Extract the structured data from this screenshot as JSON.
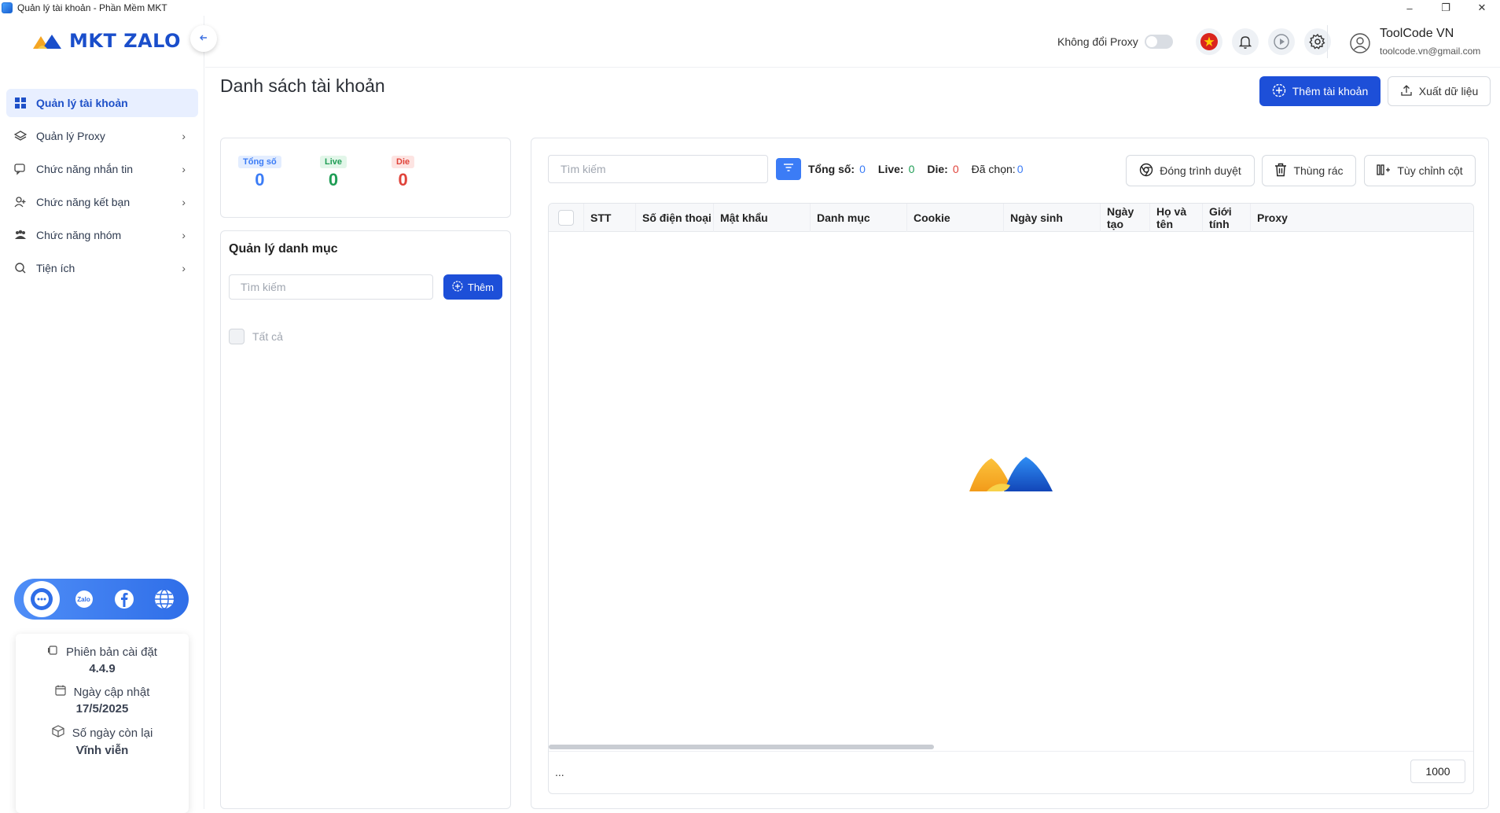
{
  "window": {
    "title": "Quản lý tài khoản - Phần Mềm MKT",
    "controls": [
      "–",
      "❐",
      "✕"
    ]
  },
  "brand": {
    "name": "MKT ZALO",
    "accent": "#1d4fd8"
  },
  "sidebar": {
    "items": [
      {
        "label": "Quản lý tài khoản",
        "icon": "grid-icon"
      },
      {
        "label": "Quản lý Proxy",
        "icon": "layers-icon"
      },
      {
        "label": "Chức năng nhắn tin",
        "icon": "chat-icon"
      },
      {
        "label": "Chức năng kết bạn",
        "icon": "user-plus-icon"
      },
      {
        "label": "Chức năng nhóm",
        "icon": "group-icon"
      },
      {
        "label": "Tiện ích",
        "icon": "search-icon"
      }
    ],
    "social": [
      "support-icon",
      "zalo-icon",
      "facebook-icon",
      "web-icon"
    ],
    "zalo_text": "Zalo",
    "info": {
      "version_label": "Phiên bản cài đặt",
      "version_value": "4.4.9",
      "update_label": "Ngày cập nhật",
      "update_value": "17/5/2025",
      "days_label": "Số ngày còn lại",
      "days_value": "Vĩnh viễn"
    }
  },
  "header": {
    "proxy_label": "Không đổi Proxy",
    "proxy_on": false,
    "user_name": "ToolCode VN",
    "user_email": "toolcode.vn@gmail.com"
  },
  "page": {
    "title": "Danh sách tài khoản",
    "add_account": "Thêm tài khoản",
    "export": "Xuất dữ liệu"
  },
  "stats": [
    {
      "label": "Tổng số",
      "value": "0",
      "color": "#3b7cf6",
      "bg": "#e3edff"
    },
    {
      "label": "Live",
      "value": "0",
      "color": "#1f9d55",
      "bg": "#e2f6e9"
    },
    {
      "label": "Die",
      "value": "0",
      "color": "#e0433a",
      "bg": "#fde4e2"
    }
  ],
  "category": {
    "title": "Quản lý danh mục",
    "search_placeholder": "Tìm kiếm",
    "add_label": "Thêm",
    "all_label": "Tất cả"
  },
  "toolbar": {
    "search_placeholder": "Tìm kiếm",
    "total_label": "Tổng số:",
    "total_value": "0",
    "live_label": "Live:",
    "live_value": "0",
    "die_label": "Die:",
    "die_value": "0",
    "selected_label": "Đã chọn:",
    "selected_value": "0",
    "close_browser": "Đóng trình duyệt",
    "trash": "Thùng rác",
    "columns": "Tùy chỉnh cột"
  },
  "table": {
    "columns": [
      "STT",
      "Số điện thoại",
      "Mật khẩu",
      "Danh mục",
      "Cookie",
      "Ngày sinh",
      "Ngày tạo",
      "Họ và tên",
      "Giới tính",
      "Proxy"
    ],
    "rows": [],
    "footer_text": "...",
    "page_size": "1000"
  }
}
